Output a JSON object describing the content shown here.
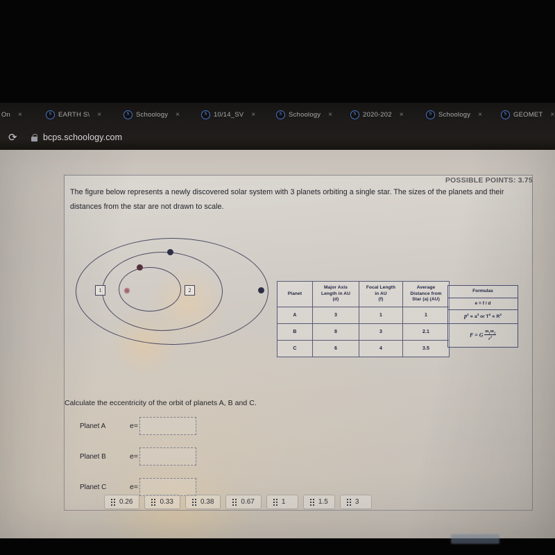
{
  "browser": {
    "tabs": [
      {
        "label": "PS On",
        "favicon": "schoology-s-icon",
        "close": "×"
      },
      {
        "label": "EARTH S\\",
        "favicon": "schoology-s-icon",
        "close": "×"
      },
      {
        "label": "Schoology",
        "favicon": "schoology-s-icon",
        "close": "×"
      },
      {
        "label": "10/14_SV",
        "favicon": "schoology-s-icon",
        "close": "×"
      },
      {
        "label": "Schoology",
        "favicon": "schoology-s-icon",
        "close": "×"
      },
      {
        "label": "2020-202",
        "favicon": "schoology-s-icon",
        "close": "×"
      },
      {
        "label": "Schoology",
        "favicon": "schoology-s-icon",
        "close": "×"
      },
      {
        "label": "GEOMET",
        "favicon": "schoology-s-icon",
        "close": "×"
      }
    ],
    "favicon_glyph": "S",
    "reload_glyph": "⟳",
    "url": "bcps.schoology.com"
  },
  "worksheet": {
    "possible_points": "POSSIBLE POINTS: 3.75",
    "prompt": "The figure below represents a newly discovered solar system with 3 planets orbiting a single star. The sizes of the planets and their distances from the star are not drawn to scale.",
    "diagram": {
      "mark_1": "1",
      "mark_2": "2"
    },
    "table": {
      "headers": [
        "Planet",
        "Major Axis Length in AU (d)",
        "Focal Length in AU (f)",
        "Average Distance from Star (a) (AU)"
      ],
      "headers_split": [
        {
          "l1": "Planet",
          "l2": "",
          "l3": ""
        },
        {
          "l1": "Major Axis",
          "l2": "Length in AU",
          "l3": "(d)"
        },
        {
          "l1": "Focal Length",
          "l2": "in AU",
          "l3": "(f)"
        },
        {
          "l1": "Average",
          "l2": "Distance from",
          "l3": "Star (a) (AU)"
        }
      ],
      "rows": [
        {
          "planet": "A",
          "major_axis": "3",
          "focal_length": "1",
          "avg_distance": "1"
        },
        {
          "planet": "B",
          "major_axis": "8",
          "focal_length": "3",
          "avg_distance": "2.1"
        },
        {
          "planet": "C",
          "major_axis": "6",
          "focal_length": "4",
          "avg_distance": "3.5"
        }
      ]
    },
    "formulas": {
      "title": "Formulas",
      "f1": "e = f / d",
      "f2_pre": "p",
      "f2_sup1": "2",
      "f2_mid": " ∝ a",
      "f2_sup2": "3",
      "f2_or": " or T",
      "f2_sup3": "2",
      "f2_tail": " ∝ R",
      "f2_sup4": "3",
      "f3_lhs": "F = G",
      "f3_num_m1": "m",
      "f3_num_s1": "1",
      "f3_num_m2": "m",
      "f3_num_s2": "2",
      "f3_den_r": "r",
      "f3_den_sup": "2"
    },
    "question": "Calculate the eccentricity of the orbit of planets A, B and C.",
    "answers": [
      {
        "label": "Planet A",
        "eq": "e=",
        "value": ""
      },
      {
        "label": "Planet B",
        "eq": "e=",
        "value": ""
      },
      {
        "label": "Planet C",
        "eq": "e=",
        "value": ""
      }
    ],
    "choices": [
      "0.26",
      "0.33",
      "0.38",
      "0.67",
      "1",
      "1.5",
      "3"
    ]
  }
}
